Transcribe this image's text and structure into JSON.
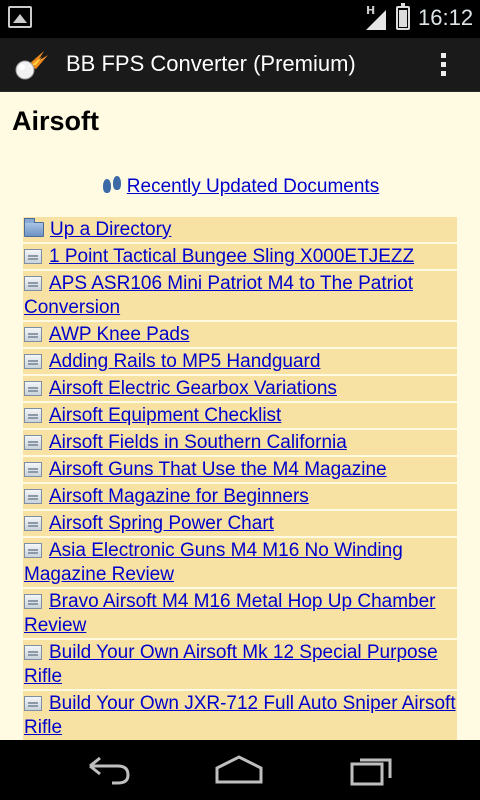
{
  "status_bar": {
    "network_label": "H",
    "time": "16:12",
    "icons": [
      "gallery-notification-icon",
      "signal-icon",
      "battery-icon"
    ]
  },
  "action_bar": {
    "title": "BB FPS Converter (Premium)",
    "icons": [
      "app-logo-icon",
      "overflow-menu-icon"
    ]
  },
  "page": {
    "heading": "Airsoft",
    "recent_link": "Recently Updated Documents",
    "up_directory": "Up a Directory",
    "documents": [
      "1 Point Tactical Bungee Sling X000ETJEZZ",
      "APS ASR106 Mini Patriot M4 to The Patriot Conversion",
      "AWP Knee Pads",
      "Adding Rails to MP5 Handguard",
      "Airsoft Electric Gearbox Variations",
      "Airsoft Equipment Checklist",
      "Airsoft Fields in Southern California",
      "Airsoft Guns That Use the M4 Magazine",
      "Airsoft Magazine for Beginners",
      "Airsoft Spring Power Chart",
      "Asia Electronic Guns M4 M16 No Winding Magazine Review",
      "Bravo Airsoft M4 M16 Metal Hop Up Chamber Review",
      "Build Your Own Airsoft Mk 12 Special Purpose Rifle",
      "Build Your Own JXR-712 Full Auto Sniper Airsoft Rifle"
    ]
  },
  "nav_bar": {
    "icons": [
      "back-icon",
      "home-icon",
      "recent-apps-icon"
    ]
  },
  "colors": {
    "content_background": "#fffbe3",
    "row_background": "#f7e2a3",
    "link": "#0000cc"
  }
}
